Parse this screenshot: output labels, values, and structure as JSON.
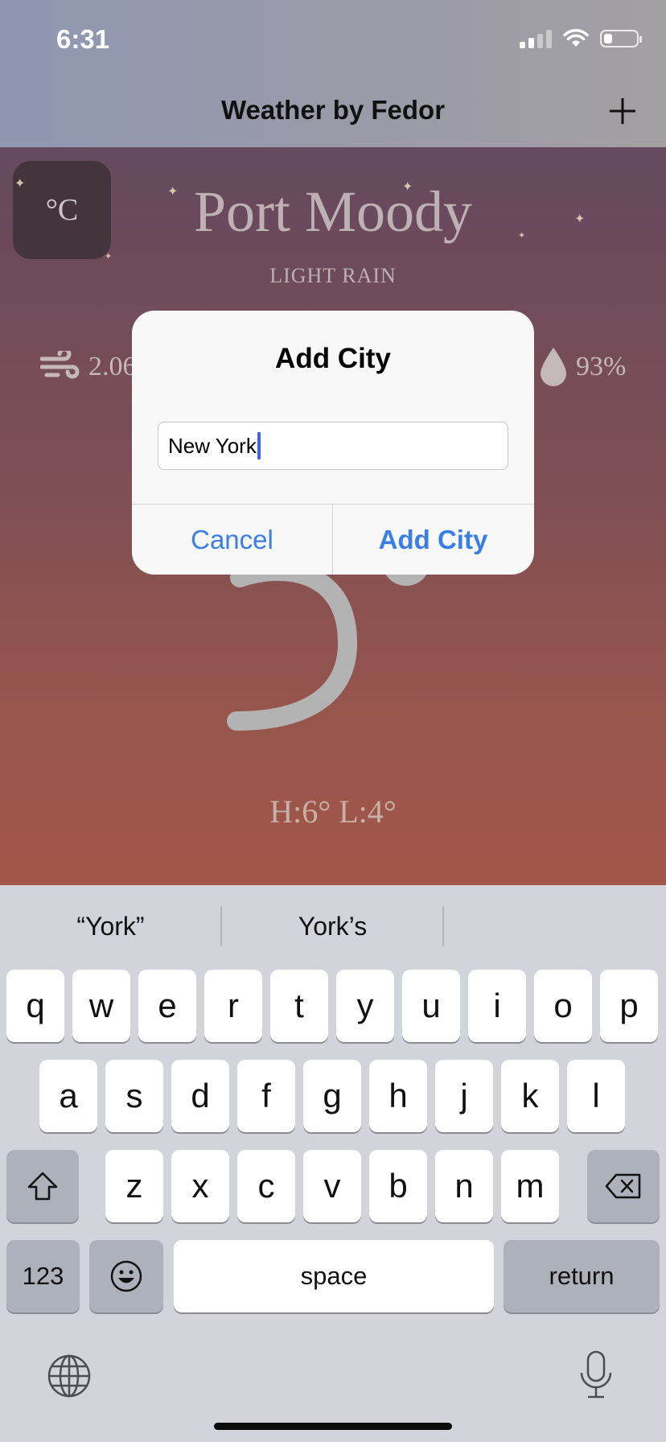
{
  "status_bar": {
    "time": "6:31"
  },
  "nav": {
    "title": "Weather by Fedor",
    "add_icon": "plus-icon"
  },
  "weather": {
    "unit_toggle": "°C",
    "city": "Port Moody",
    "condition": "LIGHT RAIN",
    "wind_partial": "2.06",
    "humidity": "93%",
    "temperature_partial": "5",
    "hi_lo": "H:6° L:4°"
  },
  "dialog": {
    "title": "Add City",
    "input_value": "New York",
    "cancel_label": "Cancel",
    "confirm_label": "Add City"
  },
  "keyboard": {
    "suggestions": [
      "“York”",
      "York’s",
      ""
    ],
    "row1": [
      "q",
      "w",
      "e",
      "r",
      "t",
      "y",
      "u",
      "i",
      "o",
      "p"
    ],
    "row2": [
      "a",
      "s",
      "d",
      "f",
      "g",
      "h",
      "j",
      "k",
      "l"
    ],
    "row3": [
      "z",
      "x",
      "c",
      "v",
      "b",
      "n",
      "m"
    ],
    "numbers_label": "123",
    "space_label": "space",
    "return_label": "return"
  }
}
